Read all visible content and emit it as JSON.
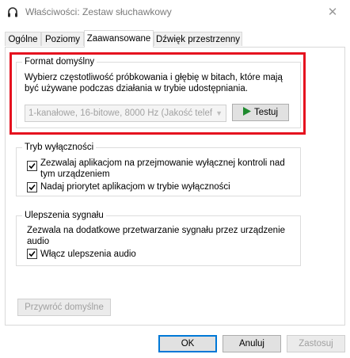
{
  "window": {
    "title": "Właściwości: Zestaw słuchawkowy",
    "close_icon": "close-icon"
  },
  "tabs": [
    {
      "label": "Ogólne",
      "active": false
    },
    {
      "label": "Poziomy",
      "active": false
    },
    {
      "label": "Zaawansowane",
      "active": true
    },
    {
      "label": "Dźwięk przestrzenny",
      "active": false
    }
  ],
  "format_group": {
    "title": "Format domyślny",
    "description": "Wybierz częstotliwość próbkowania i głębię w bitach, które mają być używane podczas działania w trybie udostępniania.",
    "description_line1": "Wybierz częstotliwość próbkowania i głębię w bitach, które mają",
    "description_line2": "być używane podczas działania w trybie udostępniania.",
    "select_value": "1-kanałowe, 16-bitowe, 8000 Hz (Jakość telef",
    "select_disabled": true,
    "test_button_label": "Testuj",
    "highlight_color": "#e5121f"
  },
  "exclusive_group": {
    "title": "Tryb wyłączności",
    "option1_line1": "Zezwalaj aplikacjom na przejmowanie wyłącznej kontroli nad",
    "option1_line2": "tym urządzeniem",
    "option1_checked": true,
    "option2_label": "Nadaj priorytet aplikacjom w trybie wyłączności",
    "option2_checked": true
  },
  "enhancements_group": {
    "title": "Ulepszenia sygnału",
    "description_line1": "Zezwala na dodatkowe przetwarzanie sygnału przez urządzenie",
    "description_line2": "audio",
    "checkbox_label": "Włącz ulepszenia audio",
    "checkbox_checked": true
  },
  "restore_defaults_label": "Przywróć domyślne",
  "footer": {
    "ok_label": "OK",
    "cancel_label": "Anuluj",
    "apply_label": "Zastosuj"
  }
}
